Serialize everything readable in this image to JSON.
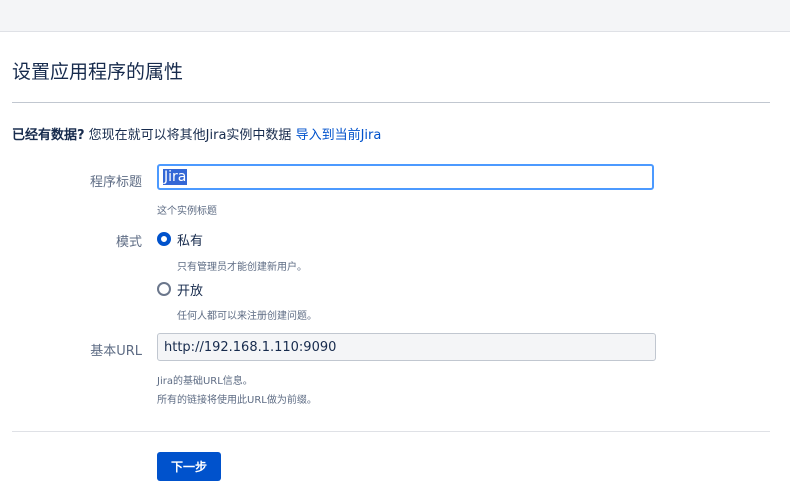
{
  "page": {
    "title": "设置应用程序的属性"
  },
  "import": {
    "question": "已经有数据?",
    "text": " 您现在就可以将其他Jira实例中数据 ",
    "link": "导入到当前Jira"
  },
  "app_title": {
    "label": "程序标题",
    "value": "Jira",
    "hint": "这个实例标题"
  },
  "mode": {
    "label": "模式",
    "options": [
      {
        "label": "私有",
        "hint": "只有管理员才能创建新用户。",
        "checked": true
      },
      {
        "label": "开放",
        "hint": "任何人都可以来注册创建问题。",
        "checked": false
      }
    ]
  },
  "base_url": {
    "label": "基本URL",
    "value": "http://192.168.1.110:9090",
    "hint1": "Jira的基础URL信息。",
    "hint2": "所有的链接将使用此URL做为前缀。"
  },
  "actions": {
    "next": "下一步"
  },
  "colors": {
    "primary": "#0052cc",
    "focus": "#4c9aff",
    "text": "#172b4d",
    "muted": "#5e6c84"
  }
}
